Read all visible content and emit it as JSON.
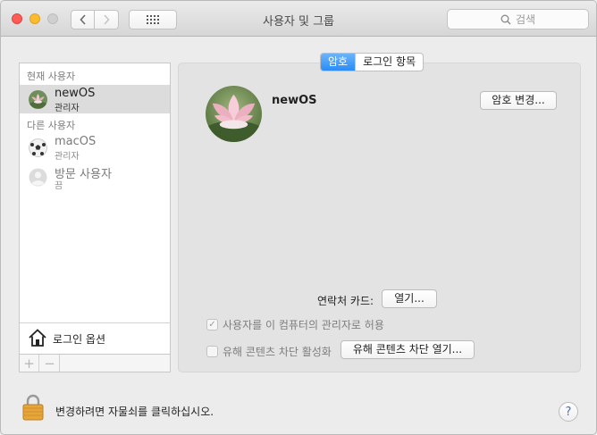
{
  "window": {
    "title": "사용자 및 그룹"
  },
  "search": {
    "placeholder": "검색"
  },
  "sidebar": {
    "current_header": "현재 사용자",
    "other_header": "다른 사용자",
    "users": [
      {
        "name": "newOS",
        "role": "관리자"
      },
      {
        "name": "macOS",
        "role": "관리자"
      },
      {
        "name": "방문 사용자",
        "role": "끔"
      }
    ],
    "login_options": "로그인 옵션",
    "add_symbol": "+",
    "remove_symbol": "−"
  },
  "tabs": [
    {
      "label": "암호",
      "active": true
    },
    {
      "label": "로그인 항목",
      "active": false
    }
  ],
  "detail": {
    "name": "newOS",
    "change_password": "암호 변경...",
    "contact_card_label": "연락처 카드:",
    "open_button": "열기...",
    "allow_admin": "사용자를 이 컴퓨터의 관리자로 허용",
    "allow_admin_checked": true,
    "parental_enable": "유해 콘텐츠 차단 활성화",
    "parental_enable_checked": false,
    "open_parental": "유해 콘텐츠 차단 열기..."
  },
  "footer": {
    "lock_text": "변경하려면 자물쇠를 클릭하십시오.",
    "help": "?"
  },
  "colors": {
    "accent": "#2a8cf8",
    "close": "#fc5b57",
    "minimize": "#fdbc2e"
  }
}
